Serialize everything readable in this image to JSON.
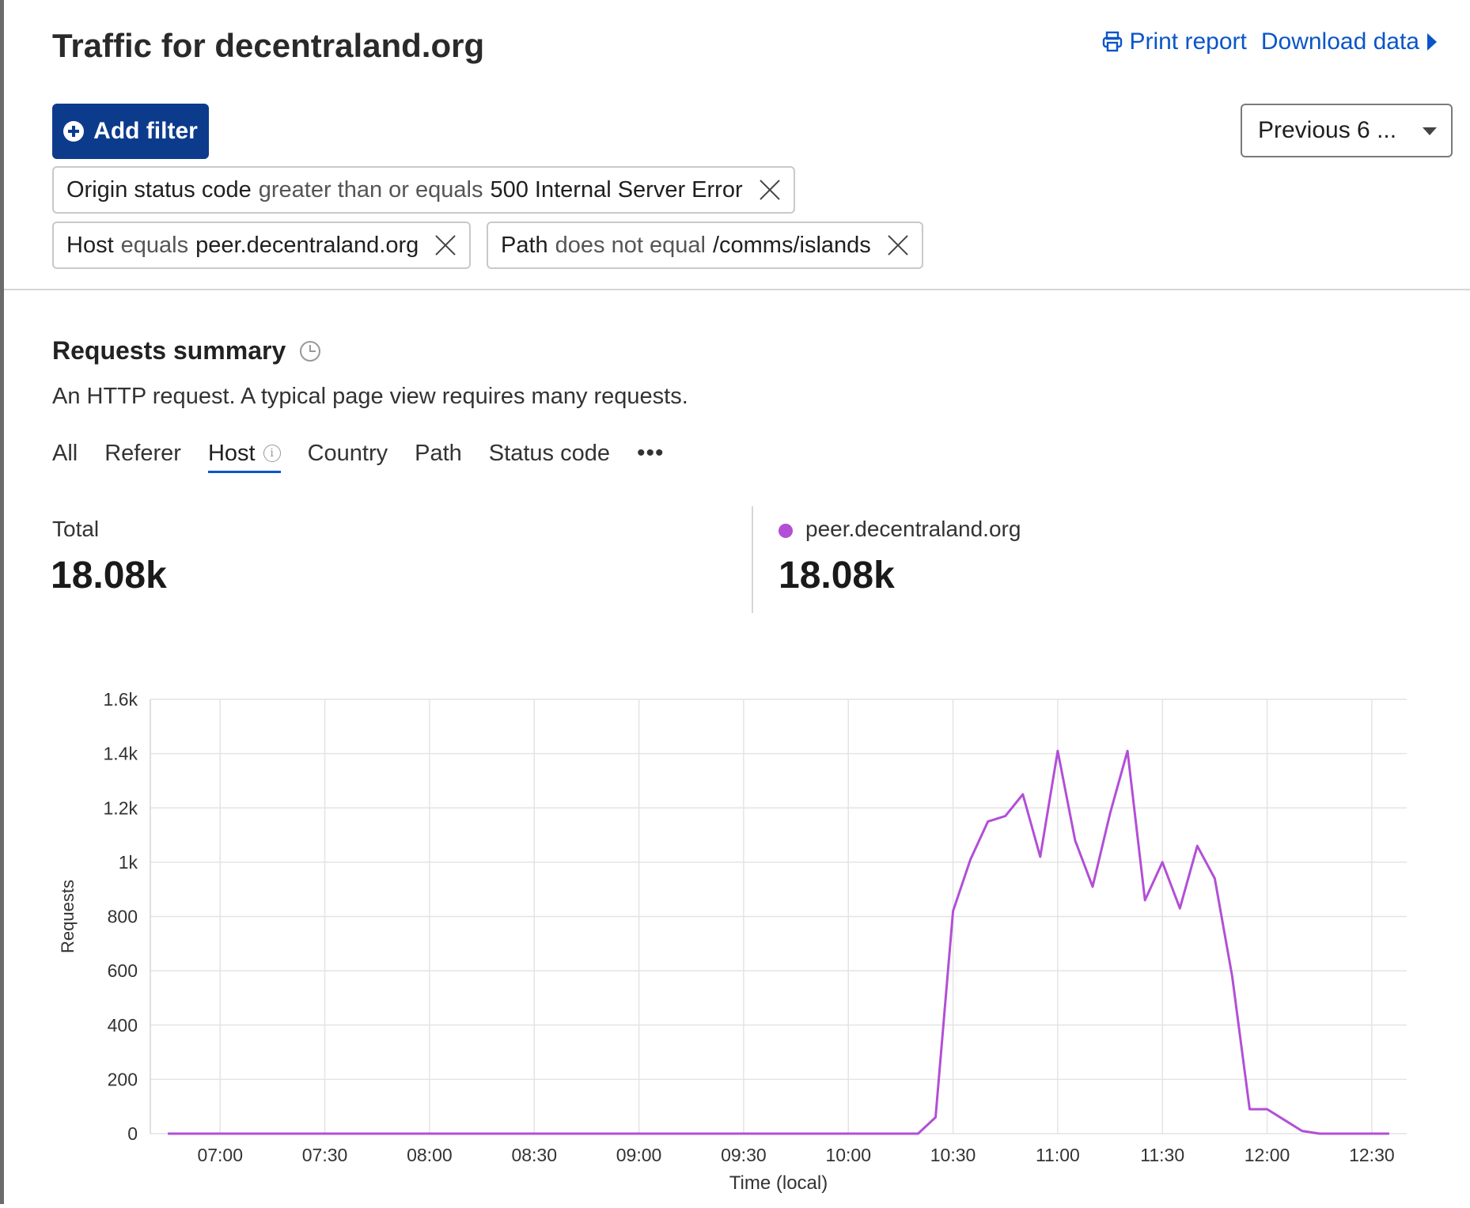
{
  "header": {
    "title": "Traffic for decentraland.org",
    "print_label": "Print report",
    "download_label": "Download data"
  },
  "toolbar": {
    "add_filter_label": "Add filter",
    "time_range": "Previous 6 ..."
  },
  "filters": [
    {
      "key": "Origin status code",
      "op": "greater than or equals",
      "value": "500 Internal Server Error"
    },
    {
      "key": "Host",
      "op": "equals",
      "value": "peer.decentraland.org"
    },
    {
      "key": "Path",
      "op": "does not equal",
      "value": "/comms/islands"
    }
  ],
  "summary": {
    "title": "Requests summary",
    "description": "An HTTP request. A typical page view requires many requests.",
    "tabs": [
      "All",
      "Referer",
      "Host",
      "Country",
      "Path",
      "Status code"
    ],
    "active_tab": "Host",
    "total_label": "Total",
    "total_value": "18.08k",
    "series_label": "peer.decentraland.org",
    "series_value": "18.08k"
  },
  "colors": {
    "accent": "#0a55c9",
    "button": "#0d3b8c",
    "series": "#b24fd6"
  },
  "chart_data": {
    "type": "line",
    "xlabel": "Time (local)",
    "ylabel": "Requests",
    "ylim": [
      0,
      1600
    ],
    "yticks": [
      0,
      200,
      400,
      600,
      800,
      1000,
      1200,
      1400,
      1600
    ],
    "ytick_labels": [
      "0",
      "200",
      "400",
      "600",
      "800",
      "1k",
      "1.2k",
      "1.4k",
      "1.6k"
    ],
    "xtick_labels": [
      "07:00",
      "07:30",
      "08:00",
      "08:30",
      "09:00",
      "09:30",
      "10:00",
      "10:30",
      "11:00",
      "11:30",
      "12:00",
      "12:30"
    ],
    "grid": true,
    "series": [
      {
        "name": "peer.decentraland.org",
        "x": [
          "06:45",
          "06:50",
          "06:55",
          "07:00",
          "07:05",
          "07:10",
          "07:15",
          "07:20",
          "07:25",
          "07:30",
          "07:35",
          "07:40",
          "07:45",
          "07:50",
          "07:55",
          "08:00",
          "08:05",
          "08:10",
          "08:15",
          "08:20",
          "08:25",
          "08:30",
          "08:35",
          "08:40",
          "08:45",
          "08:50",
          "08:55",
          "09:00",
          "09:05",
          "09:10",
          "09:15",
          "09:20",
          "09:25",
          "09:30",
          "09:35",
          "09:40",
          "09:45",
          "09:50",
          "09:55",
          "10:00",
          "10:05",
          "10:10",
          "10:15",
          "10:20",
          "10:25",
          "10:30",
          "10:35",
          "10:40",
          "10:45",
          "10:50",
          "10:55",
          "11:00",
          "11:05",
          "11:10",
          "11:15",
          "11:20",
          "11:25",
          "11:30",
          "11:35",
          "11:40",
          "11:45",
          "11:50",
          "11:55",
          "12:00",
          "12:05",
          "12:10",
          "12:15",
          "12:20",
          "12:25",
          "12:30",
          "12:35"
        ],
        "y": [
          0,
          0,
          0,
          0,
          0,
          0,
          0,
          0,
          0,
          0,
          0,
          0,
          0,
          0,
          0,
          0,
          0,
          0,
          0,
          0,
          0,
          0,
          0,
          0,
          0,
          0,
          0,
          0,
          0,
          0,
          0,
          0,
          0,
          0,
          0,
          0,
          0,
          0,
          0,
          0,
          0,
          0,
          0,
          0,
          60,
          820,
          1010,
          1150,
          1170,
          1250,
          1020,
          1410,
          1080,
          910,
          1180,
          1410,
          860,
          1000,
          830,
          1060,
          940,
          580,
          90,
          90,
          50,
          10,
          0,
          0,
          0,
          0,
          0
        ]
      }
    ]
  }
}
